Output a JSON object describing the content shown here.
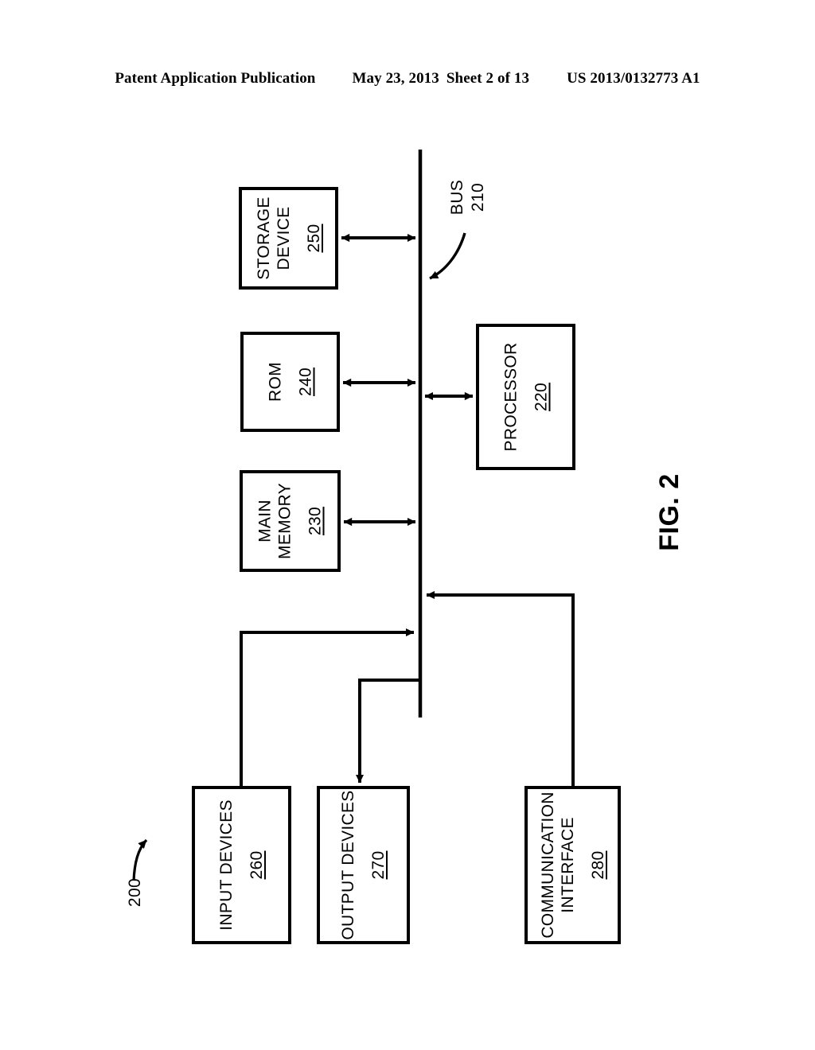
{
  "header": {
    "publication": "Patent Application Publication",
    "date": "May 23, 2013",
    "sheet": "Sheet 2 of 13",
    "patent_number": "US 2013/0132773 A1"
  },
  "figure": {
    "label": "FIG. 2",
    "system_ref": "200"
  },
  "diagram": {
    "bus": {
      "label": "BUS",
      "ref": "210"
    },
    "blocks": [
      {
        "id": "storage-device",
        "name": "STORAGE DEVICE",
        "lines": [
          "STORAGE",
          "DEVICE"
        ],
        "ref": "250"
      },
      {
        "id": "rom",
        "name": "ROM",
        "lines": [
          "ROM"
        ],
        "ref": "240"
      },
      {
        "id": "main-memory",
        "name": "MAIN MEMORY",
        "lines": [
          "MAIN",
          "MEMORY"
        ],
        "ref": "230"
      },
      {
        "id": "processor",
        "name": "PROCESSOR",
        "lines": [
          "PROCESSOR"
        ],
        "ref": "220"
      },
      {
        "id": "input-devices",
        "name": "INPUT DEVICES",
        "lines": [
          "INPUT DEVICES"
        ],
        "ref": "260"
      },
      {
        "id": "output-devices",
        "name": "OUTPUT DEVICES",
        "lines": [
          "OUTPUT DEVICES"
        ],
        "ref": "270"
      },
      {
        "id": "communication-interface",
        "name": "COMMUNICATION INTERFACE",
        "lines": [
          "COMMUNICATION",
          "INTERFACE"
        ],
        "ref": "280"
      }
    ],
    "colors": {
      "ink": "#000000",
      "paper": "#ffffff"
    }
  }
}
